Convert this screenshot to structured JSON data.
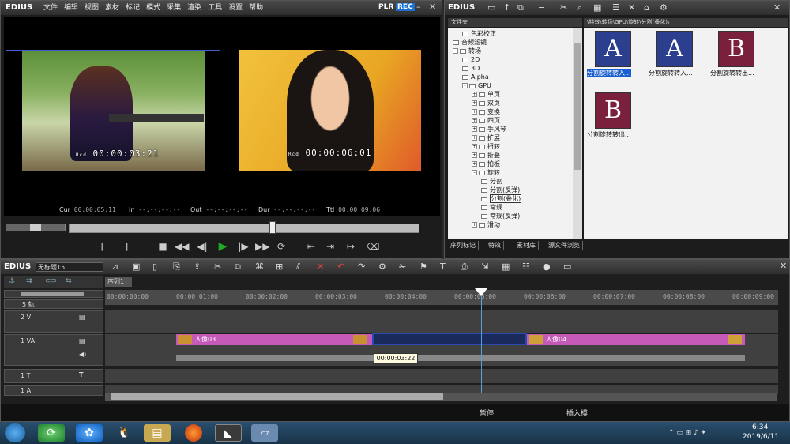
{
  "player": {
    "app_name": "EDIUS",
    "menu": [
      "文件",
      "编辑",
      "视图",
      "素材",
      "标记",
      "模式",
      "采集",
      "渲染",
      "工具",
      "设置",
      "帮助"
    ],
    "plr_label": "PLR",
    "rec_label": "REC",
    "left_timecode": "00:00:03:21",
    "right_timecode": "00:00:06:01",
    "tc_prefix": "Rcd",
    "cur_label": "Cur",
    "cur_value": "00:00:05:11",
    "in_label": "In",
    "in_value": "--:--:--:--",
    "out_label": "Out",
    "out_value": "--:--:--:--",
    "dur_label": "Dur",
    "dur_value": "--:--:--:--",
    "ttl_label": "Ttl",
    "ttl_value": "00:00:09:06",
    "scrub_position": 0.58
  },
  "library": {
    "title": "EDIUS",
    "tree_header": "文件夹",
    "path": "\\特效\\转场\\GPU\\旋转\\分割(叠化)\\",
    "tree": [
      {
        "label": "色彩校正",
        "indent": 4,
        "type": "folder"
      },
      {
        "label": "音频滤镜",
        "indent": 3,
        "type": "folder"
      },
      {
        "label": "转场",
        "indent": 3,
        "type": "open",
        "exp": "-"
      },
      {
        "label": "2D",
        "indent": 4,
        "type": "folder"
      },
      {
        "label": "3D",
        "indent": 4,
        "type": "folder"
      },
      {
        "label": "Alpha",
        "indent": 4,
        "type": "folder"
      },
      {
        "label": "GPU",
        "indent": 4,
        "type": "open",
        "exp": "-"
      },
      {
        "label": "单页",
        "indent": 5,
        "type": "folder",
        "exp": "+"
      },
      {
        "label": "双页",
        "indent": 5,
        "type": "folder",
        "exp": "+"
      },
      {
        "label": "变换",
        "indent": 5,
        "type": "folder",
        "exp": "+"
      },
      {
        "label": "四页",
        "indent": 5,
        "type": "folder",
        "exp": "+"
      },
      {
        "label": "手风琴",
        "indent": 5,
        "type": "folder",
        "exp": "+"
      },
      {
        "label": "扩展",
        "indent": 5,
        "type": "folder",
        "exp": "+"
      },
      {
        "label": "扭转",
        "indent": 5,
        "type": "folder",
        "exp": "+"
      },
      {
        "label": "折叠",
        "indent": 5,
        "type": "folder",
        "exp": "+"
      },
      {
        "label": "拍板",
        "indent": 5,
        "type": "folder",
        "exp": "+"
      },
      {
        "label": "旋转",
        "indent": 5,
        "type": "open",
        "exp": "-"
      },
      {
        "label": "分割",
        "indent": 6,
        "type": "folder"
      },
      {
        "label": "分割(反弹)",
        "indent": 6,
        "type": "folder"
      },
      {
        "label": "分割(叠化)",
        "indent": 6,
        "type": "folder",
        "selected": true
      },
      {
        "label": "常规",
        "indent": 6,
        "type": "folder"
      },
      {
        "label": "常规(反弹)",
        "indent": 6,
        "type": "folder"
      },
      {
        "label": "滑动",
        "indent": 5,
        "type": "folder",
        "exp": "+"
      }
    ],
    "assets": [
      {
        "letter": "A",
        "label": "分割旋转转入...",
        "style": "blue",
        "selected": true
      },
      {
        "letter": "A",
        "label": "分割旋转转入...",
        "style": "blue"
      },
      {
        "letter": "B",
        "label": "分割旋转转出...",
        "style": "red"
      },
      {
        "letter": "B",
        "label": "分割旋转转出...",
        "style": "red"
      }
    ],
    "tabs": [
      "序列标记",
      "特效",
      "素材库",
      "源文件浏览"
    ]
  },
  "timeline": {
    "app_name": "EDIUS",
    "project_name": "无标题15",
    "sequence_tab": "序列1",
    "track_count_label": "5 轨",
    "ruler_ticks": [
      "00:00:00:00",
      "00:00:01:00",
      "00:00:02:00",
      "00:00:03:00",
      "00:00:04:00",
      "00:00:05:00",
      "00:00:06:00",
      "00:00:07:00",
      "00:00:08:00",
      "00:00:09:00"
    ],
    "tracks": [
      {
        "label": "2 V",
        "row": "v2"
      },
      {
        "label": "1 VA",
        "row": "va"
      },
      {
        "label": "1 T",
        "row": "t"
      },
      {
        "label": "1 A",
        "row": "a"
      }
    ],
    "clip1_label": "人像03",
    "clip2_label": "人像04",
    "tooltip": "00:00:03:22",
    "status_label": "暂停",
    "status_insert": "插入模"
  },
  "taskbar": {
    "time": "6:34",
    "date": "2019/6/11"
  },
  "colors": {
    "clip": "#c459b8",
    "playhead": "#ffffff",
    "accent_green": "#22aa22"
  }
}
